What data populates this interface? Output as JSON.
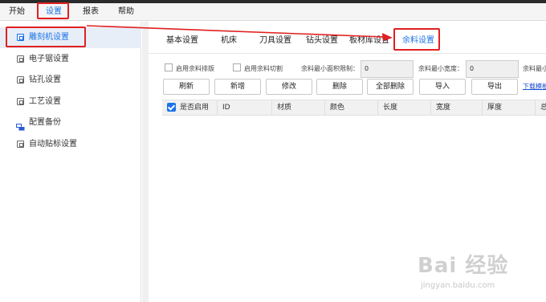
{
  "menubar": {
    "items": [
      {
        "label": "开始",
        "active": false
      },
      {
        "label": "设置",
        "active": true
      },
      {
        "label": "报表",
        "active": false
      },
      {
        "label": "帮助",
        "active": false
      }
    ]
  },
  "sidebar": {
    "items": [
      {
        "label": "雕刻机设置",
        "active": true,
        "icon": "device-icon"
      },
      {
        "label": "电子锯设置",
        "active": false,
        "icon": "device-icon"
      },
      {
        "label": "钻孔设置",
        "active": false,
        "icon": "device-icon"
      },
      {
        "label": "工艺设置",
        "active": false,
        "icon": "device-icon"
      },
      {
        "label": "配置备份",
        "active": false,
        "icon": "backup-icon"
      },
      {
        "label": "自动贴标设置",
        "active": false,
        "icon": "device-icon"
      }
    ]
  },
  "tabs": [
    {
      "label": "基本设置",
      "active": false
    },
    {
      "label": "机床",
      "active": false
    },
    {
      "label": "刀具设置",
      "active": false
    },
    {
      "label": "钻头设置",
      "active": false
    },
    {
      "label": "板材库设置",
      "active": false
    },
    {
      "label": "余料设置",
      "active": true
    }
  ],
  "controls": {
    "enable_remnant_layout": "启用余料排版",
    "enable_remnant_cut": "启用余料切割",
    "min_area_label": "余料最小面积限制：",
    "min_area_value": "0",
    "min_width_label": "余料最小宽度：",
    "min_width_value": "0",
    "min_length_label": "余料最小"
  },
  "buttons": [
    {
      "label": "刷新"
    },
    {
      "label": "新增"
    },
    {
      "label": "修改"
    },
    {
      "label": "删除"
    },
    {
      "label": "全部删除"
    },
    {
      "label": "导入"
    },
    {
      "label": "导出"
    }
  ],
  "link": {
    "label": "下载模板"
  },
  "table": {
    "columns": [
      "是否启用",
      "ID",
      "材质",
      "颜色",
      "长度",
      "宽度",
      "厚度",
      "总"
    ]
  },
  "watermark": {
    "main": "Bai 经验",
    "sub": "jingyan.baidu.com"
  },
  "colors": {
    "accent": "#1a73e8",
    "highlight": "#e02020",
    "selected_bg": "#e8eef8"
  }
}
